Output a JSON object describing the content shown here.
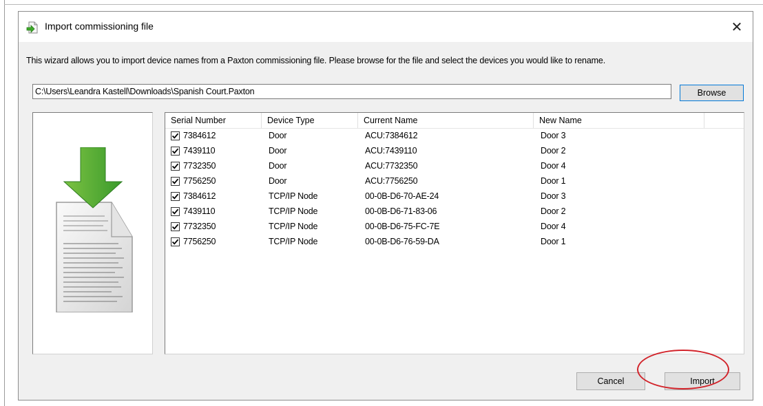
{
  "window": {
    "title": "Import commissioning file",
    "close_glyph": "✕"
  },
  "intro_text": "This wizard allows you to import device names from a Paxton commissioning file. Please browse for the file and select the devices you would like to rename.",
  "file_path": {
    "value": "C:\\Users\\Leandra Kastell\\Downloads\\Spanish Court.Paxton"
  },
  "buttons": {
    "browse": "Browse",
    "cancel": "Cancel",
    "import": "Import"
  },
  "table": {
    "columns": [
      "Serial Number",
      "Device Type",
      "Current Name",
      "New Name"
    ],
    "rows": [
      {
        "checked": true,
        "serial": "7384612",
        "type": "Door",
        "current": "ACU:7384612",
        "new": "Door 3"
      },
      {
        "checked": true,
        "serial": "7439110",
        "type": "Door",
        "current": "ACU:7439110",
        "new": "Door 2"
      },
      {
        "checked": true,
        "serial": "7732350",
        "type": "Door",
        "current": "ACU:7732350",
        "new": "Door 4"
      },
      {
        "checked": true,
        "serial": "7756250",
        "type": "Door",
        "current": "ACU:7756250",
        "new": "Door 1"
      },
      {
        "checked": true,
        "serial": "7384612",
        "type": "TCP/IP Node",
        "current": "00-0B-D6-70-AE-24",
        "new": "Door 3"
      },
      {
        "checked": true,
        "serial": "7439110",
        "type": "TCP/IP Node",
        "current": "00-0B-D6-71-83-06",
        "new": "Door 2"
      },
      {
        "checked": true,
        "serial": "7732350",
        "type": "TCP/IP Node",
        "current": "00-0B-D6-75-FC-7E",
        "new": "Door 4"
      },
      {
        "checked": true,
        "serial": "7756250",
        "type": "TCP/IP Node",
        "current": "00-0B-D6-76-59-DA",
        "new": "Door 1"
      }
    ]
  },
  "icons": {
    "title": "import-file-icon",
    "large": "download-document-icon"
  },
  "colors": {
    "highlight": "#d2232a",
    "arrow": "#3faa2a",
    "focus": "#0078d7"
  }
}
